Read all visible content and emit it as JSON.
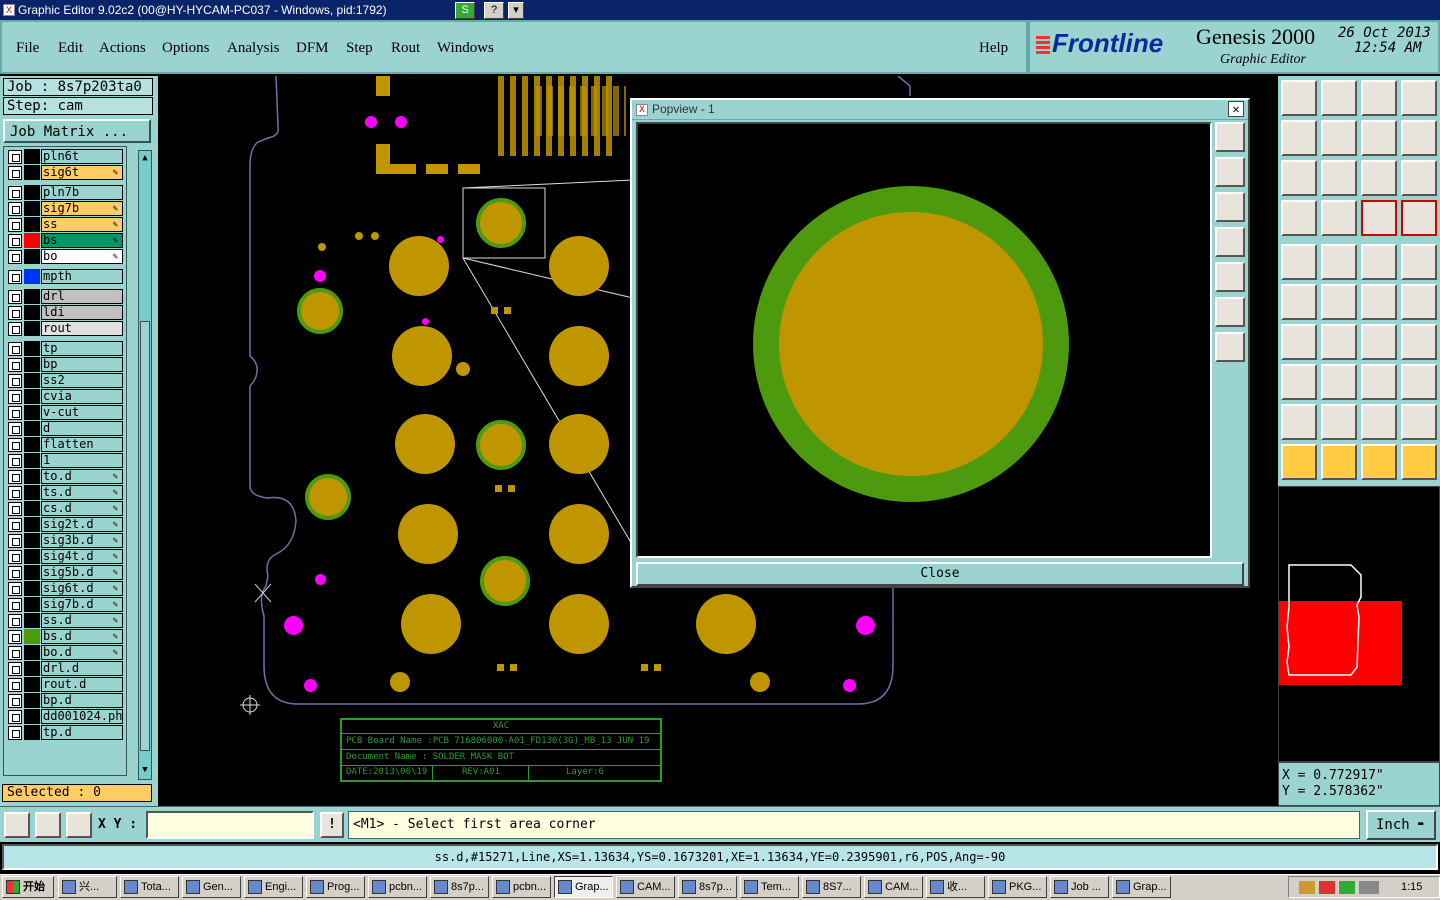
{
  "window": {
    "title": "Graphic Editor 9.02c2 (00@HY-HYCAM-PC037 - Windows, pid:1792)"
  },
  "menu": [
    "File",
    "Edit",
    "Actions",
    "Options",
    "Analysis",
    "DFM",
    "Step",
    "Rout",
    "Windows"
  ],
  "help_label": "Help",
  "brand": {
    "logo": "Frontline",
    "product": "Genesis 2000",
    "subtitle": "Graphic Editor",
    "date": "26 Oct 2013",
    "time": "12:54 AM"
  },
  "job": {
    "job_label": "Job : 8s7p203ta0",
    "step_label": "Step: cam",
    "matrix_button": "Job Matrix ..."
  },
  "layers": [
    {
      "name": "pln6t",
      "color": "#000000",
      "bg": "#9ad3d0",
      "edit": false
    },
    {
      "name": "sig6t",
      "color": "#000000",
      "bg": "#ffcc66",
      "edit": true
    },
    {
      "name": "pln7b",
      "color": "#000000",
      "bg": "#9ad3d0",
      "edit": false
    },
    {
      "name": "sig7b",
      "color": "#000000",
      "bg": "#ffcc66",
      "edit": true
    },
    {
      "name": "ss",
      "color": "#000000",
      "bg": "#ffcc66",
      "edit": true
    },
    {
      "name": "bs",
      "color": "#ff0000",
      "bg": "#009966",
      "edit": true
    },
    {
      "name": "bo",
      "color": "#000000",
      "bg": "#ffffff",
      "edit": true
    },
    {
      "name": "mpth",
      "color": "#0033ff",
      "bg": "#9ad3d0",
      "edit": false
    },
    {
      "name": "drl",
      "color": "#000000",
      "bg": "#c0c0c0",
      "edit": false
    },
    {
      "name": "ldi",
      "color": "#000000",
      "bg": "#c0c0c0",
      "edit": false
    },
    {
      "name": "rout",
      "color": "#000000",
      "bg": "#e0e0e0",
      "edit": false
    },
    {
      "name": "tp",
      "color": "#000000",
      "bg": "#9ad3d0",
      "edit": false
    },
    {
      "name": "bp",
      "color": "#000000",
      "bg": "#9ad3d0",
      "edit": false
    },
    {
      "name": "ss2",
      "color": "#000000",
      "bg": "#9ad3d0",
      "edit": false
    },
    {
      "name": "cvia",
      "color": "#000000",
      "bg": "#9ad3d0",
      "edit": false
    },
    {
      "name": "v-cut",
      "color": "#000000",
      "bg": "#9ad3d0",
      "edit": false
    },
    {
      "name": "d",
      "color": "#000000",
      "bg": "#9ad3d0",
      "edit": false
    },
    {
      "name": "flatten",
      "color": "#000000",
      "bg": "#9ad3d0",
      "edit": false
    },
    {
      "name": "1",
      "color": "#000000",
      "bg": "#9ad3d0",
      "edit": false
    },
    {
      "name": "to.d",
      "color": "#000000",
      "bg": "#9ad3d0",
      "edit": true
    },
    {
      "name": "ts.d",
      "color": "#000000",
      "bg": "#9ad3d0",
      "edit": true
    },
    {
      "name": "cs.d",
      "color": "#000000",
      "bg": "#9ad3d0",
      "edit": true
    },
    {
      "name": "sig2t.d",
      "color": "#000000",
      "bg": "#9ad3d0",
      "edit": true
    },
    {
      "name": "sig3b.d",
      "color": "#000000",
      "bg": "#9ad3d0",
      "edit": true
    },
    {
      "name": "sig4t.d",
      "color": "#000000",
      "bg": "#9ad3d0",
      "edit": true
    },
    {
      "name": "sig5b.d",
      "color": "#000000",
      "bg": "#9ad3d0",
      "edit": true
    },
    {
      "name": "sig6t.d",
      "color": "#000000",
      "bg": "#9ad3d0",
      "edit": true
    },
    {
      "name": "sig7b.d",
      "color": "#000000",
      "bg": "#9ad3d0",
      "edit": true
    },
    {
      "name": "ss.d",
      "color": "#000000",
      "bg": "#9ad3d0",
      "edit": true
    },
    {
      "name": "bs.d",
      "color": "#4e9a0e",
      "bg": "#9ad3d0",
      "edit": true
    },
    {
      "name": "bo.d",
      "color": "#000000",
      "bg": "#9ad3d0",
      "edit": true
    },
    {
      "name": "drl.d",
      "color": "#000000",
      "bg": "#9ad3d0",
      "edit": false
    },
    {
      "name": "rout.d",
      "color": "#000000",
      "bg": "#9ad3d0",
      "edit": false
    },
    {
      "name": "bp.d",
      "color": "#000000",
      "bg": "#9ad3d0",
      "edit": false
    },
    {
      "name": "dd001024.pho",
      "color": "#000000",
      "bg": "#9ad3d0",
      "edit": false
    },
    {
      "name": "tp.d",
      "color": "#000000",
      "bg": "#9ad3d0",
      "edit": false
    }
  ],
  "selected": "Selected : 0",
  "popview": {
    "title": "Popview - 1",
    "close_label": "Close"
  },
  "titleblock": {
    "top": "XAC",
    "board": "PCB Board Name :PCB 716806000-A01_FD130(3G)_MB_13 JUN 19",
    "document": "Document Name :  SOLDER MASK BOT",
    "date": "DATE:2013\\06\\19",
    "rev": "REV:A01",
    "layer": "Layer:6"
  },
  "coords": {
    "x": "X = 0.772917\"",
    "y": "Y = 2.578362\""
  },
  "cmd": {
    "xy_label": "X Y :",
    "xy_value": "",
    "prompt": "<M1> - Select first area corner",
    "unit": "Inch"
  },
  "status": "ss.d,#15271,Line,XS=1.13634,YS=0.1673201,XE=1.13634,YE=0.2395901,r6,POS,Ang=-90",
  "taskbar": {
    "start": "开始",
    "items": [
      "兴...",
      "Tota...",
      "Gen...",
      "Engi...",
      "Prog...",
      "pcbn...",
      "8s7p...",
      "pcbn...",
      "Grap...",
      "CAM...",
      "8s7p...",
      "Tem...",
      "8S7...",
      "CAM...",
      "收...",
      "PKG...",
      "Job ...",
      "Grap..."
    ],
    "clock": "1:15"
  },
  "colors": {
    "cyan_panel": "#9ad3d0",
    "pad": "#bf9600",
    "mask_ring": "#4e9a0e",
    "magenta": "#ff00ff"
  }
}
